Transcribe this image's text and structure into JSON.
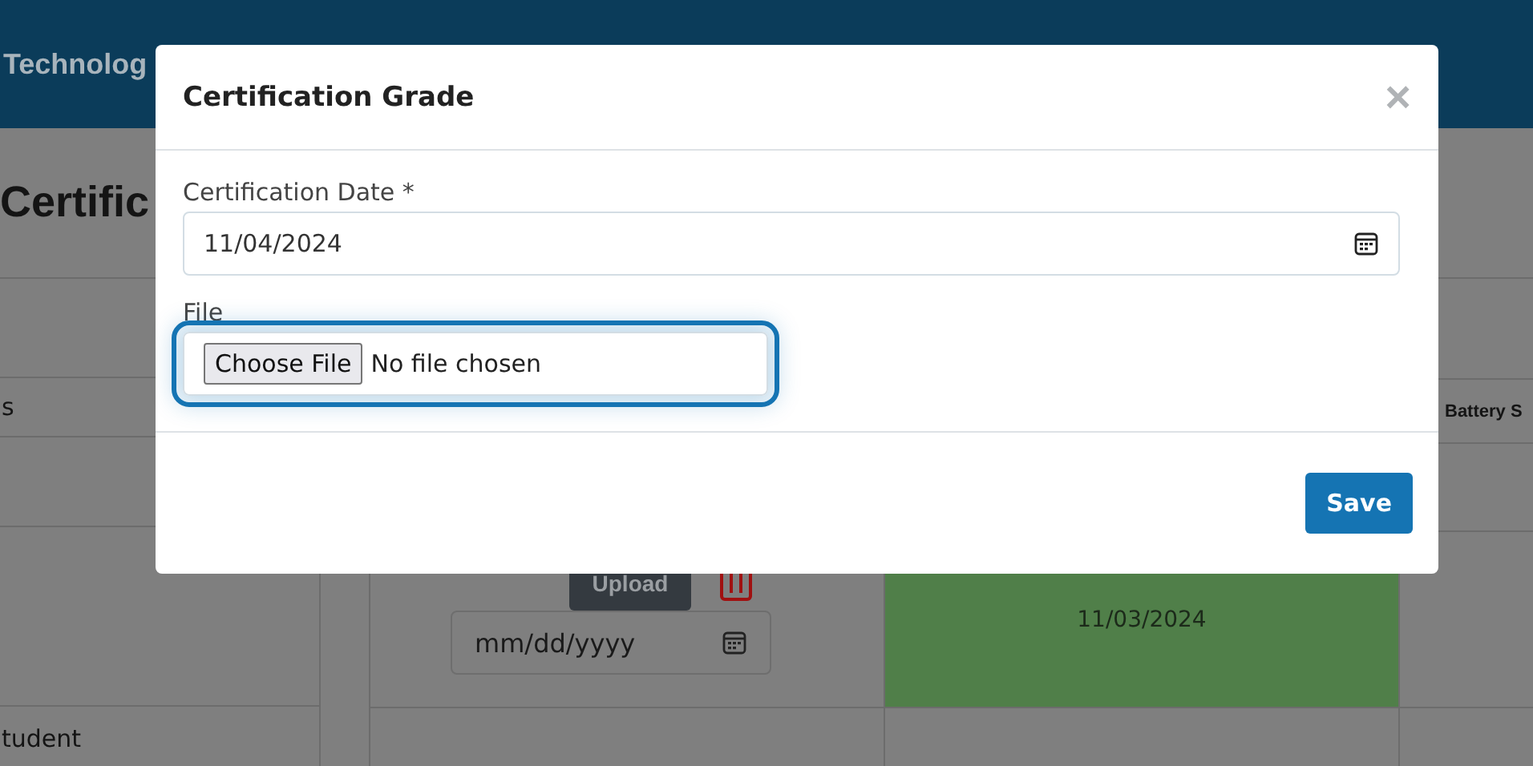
{
  "header": {
    "brand": "Technolog"
  },
  "page_title": "Certific",
  "side_rows": [
    "s",
    "tudent"
  ],
  "table": {
    "header_cell": "Battery S",
    "upload_button": "Upload",
    "date_placeholder": "mm/dd/yyyy",
    "status_date": "11/03/2024"
  },
  "modal": {
    "title": "Certification Grade",
    "close": "×",
    "fields": [
      {
        "kind": "date",
        "label": "Certification Date *",
        "value": "11/04/2024",
        "focused": false
      },
      {
        "kind": "file",
        "label": "File",
        "button": "Choose File",
        "value": "No file chosen",
        "focused": true
      }
    ],
    "buttons": [
      "Save"
    ]
  }
}
